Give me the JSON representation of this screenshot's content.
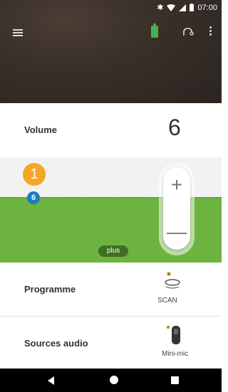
{
  "status_bar": {
    "time": "07:00",
    "icons": [
      "bluetooth-icon",
      "wifi-icon",
      "signal-icon",
      "battery-icon"
    ]
  },
  "app_bar": {
    "icons": [
      "menu-icon",
      "hearing-aid-battery-icon",
      "hearing-aid-icon",
      "more-options-icon"
    ]
  },
  "volume": {
    "label": "Volume",
    "value": "6"
  },
  "level": {
    "marker": "1",
    "current": "6",
    "extra_label": "plus"
  },
  "programme": {
    "label": "Programme",
    "icon": "scan-icon",
    "sub": "SCAN"
  },
  "sources": {
    "label": "Sources audio",
    "icon": "mini-mic-icon",
    "sub": "Mini-mic"
  },
  "slider": {
    "plus_symbol": "+",
    "minus_symbol": "—"
  },
  "colors": {
    "accent_green": "#6cb33f",
    "badge_orange": "#f5a623",
    "badge_blue": "#1f7bbf",
    "header_brown": "#3a302a"
  }
}
